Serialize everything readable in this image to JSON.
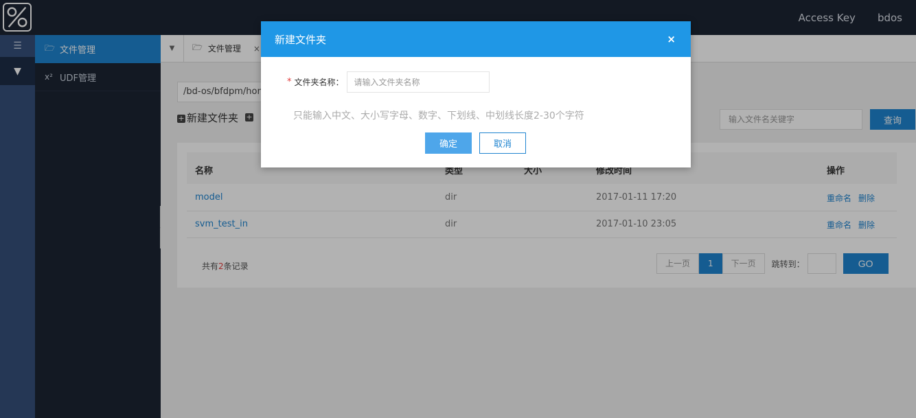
{
  "header": {
    "access_key": "Access Key",
    "user": "bdos"
  },
  "sidemenu": {
    "items": [
      {
        "icon": "folder-open-icon",
        "label": "文件管理"
      },
      {
        "icon": "superscript-icon",
        "label": "UDF管理"
      }
    ]
  },
  "tabs": [
    {
      "label": "文件管理",
      "close": "×"
    }
  ],
  "path": "/bd-os/bfdpm/hom",
  "toolbar": {
    "new_folder": "新建文件夹"
  },
  "search": {
    "placeholder": "输入文件名关键字",
    "button": "查询"
  },
  "table": {
    "columns": {
      "name": "名称",
      "type": "类型",
      "size": "大小",
      "mtime": "修改时间",
      "ops": "操作"
    },
    "rows": [
      {
        "name": "model",
        "type": "dir",
        "size": "",
        "mtime": "2017-01-11 17:20",
        "rename": "重命名",
        "delete": "删除"
      },
      {
        "name": "svm_test_in",
        "type": "dir",
        "size": "",
        "mtime": "2017-01-10 23:05",
        "rename": "重命名",
        "delete": "删除"
      }
    ]
  },
  "footer": {
    "count_prefix": "共有",
    "count": "2",
    "count_suffix": "条记录"
  },
  "pager": {
    "prev": "上一页",
    "current": "1",
    "next": "下一页",
    "jump_label": "跳转到：",
    "go": "GO"
  },
  "modal": {
    "title": "新建文件夹",
    "close": "×",
    "required_mark": "*",
    "field_label": "文件夹名称：",
    "field_placeholder": "请输入文件夹名称",
    "hint": "只能输入中文、大小写字母、数字、下划线、中划线长度2-30个字符",
    "ok": "确定",
    "cancel": "取消"
  },
  "colors": {
    "primary": "#1f84d0",
    "modal_header": "#1f97e6",
    "topbar": "#1c2433",
    "rail": "#35507a",
    "danger": "#e23b3b"
  }
}
